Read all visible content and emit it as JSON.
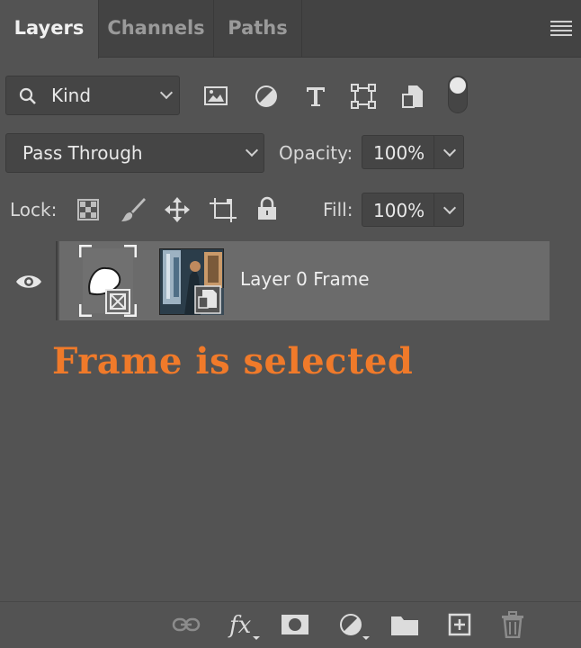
{
  "tabs": [
    {
      "label": "Layers",
      "active": true
    },
    {
      "label": "Channels",
      "active": false
    },
    {
      "label": "Paths",
      "active": false
    }
  ],
  "filter": {
    "kind_label": "Kind",
    "filter_icons": [
      "image-filter-icon",
      "adjustment-filter-icon",
      "type-filter-icon",
      "shape-filter-icon",
      "smart-object-filter-icon",
      "filter-toggle-icon"
    ]
  },
  "blend": {
    "mode": "Pass Through",
    "opacity_label": "Opacity:",
    "opacity_value": "100%"
  },
  "lock": {
    "label": "Lock:",
    "fill_label": "Fill:",
    "fill_value": "100%",
    "lock_icons": [
      "lock-transparent-icon",
      "lock-image-icon",
      "lock-position-icon",
      "lock-artboard-icon",
      "lock-all-icon"
    ]
  },
  "layers": [
    {
      "name": "Layer 0 Frame",
      "visible": true,
      "selected_part": "frame"
    }
  ],
  "annotation": "Frame is selected",
  "bottom_icons": [
    "link-layers-icon",
    "fx-icon",
    "add-mask-icon",
    "new-adjustment-icon",
    "new-group-icon",
    "new-layer-icon",
    "delete-icon"
  ],
  "colors": {
    "panel_bg": "#535353",
    "tab_bar_bg": "#434343",
    "selected_row": "#6b6b6b",
    "annotation": "#f07a2a"
  }
}
